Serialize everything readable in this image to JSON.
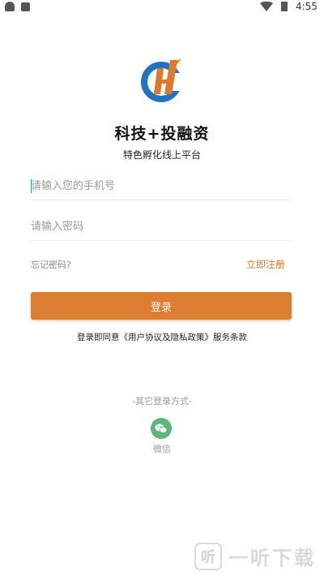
{
  "status_bar": {
    "time": "4:55"
  },
  "app": {
    "title": "科技+投融资",
    "subtitle": "特色孵化线上平台"
  },
  "form": {
    "phone_placeholder": "请输入您的手机号",
    "password_placeholder": "请输入密码",
    "forgot_label": "忘记密码?",
    "register_label": "立即注册",
    "login_label": "登录"
  },
  "agreement": {
    "prefix": "登录即同意",
    "link": "《用户协议及隐私政策》",
    "suffix": "服务条款"
  },
  "other_login": {
    "title": "-其它登录方式-",
    "wechat_label": "微信"
  },
  "watermark": {
    "text": "一听下载",
    "logo_char": "听"
  },
  "colors": {
    "accent": "#dd7d2f",
    "wechat": "#5cb57a",
    "caret": "#2ea2a2"
  }
}
